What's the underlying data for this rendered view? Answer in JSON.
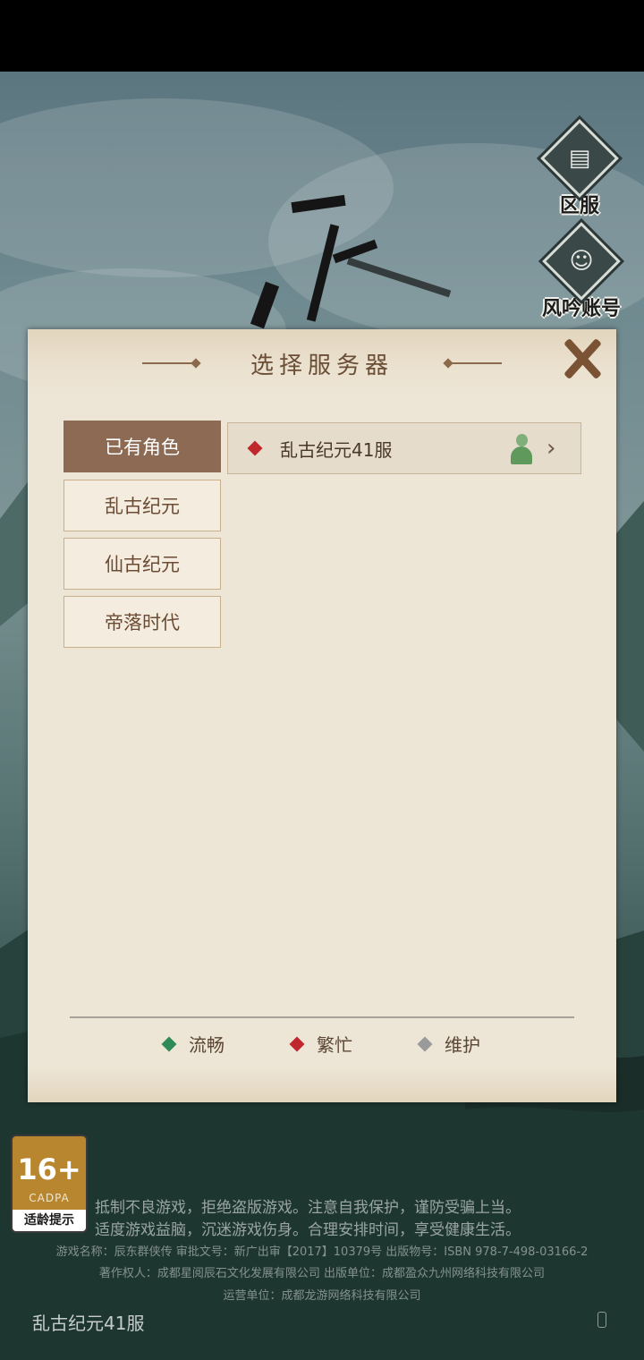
{
  "side_buttons": {
    "server": {
      "label": "区服",
      "icon": "gate-icon"
    },
    "account": {
      "label": "风吟账号",
      "icon": "user-icon"
    }
  },
  "dialog": {
    "title": "选择服务器",
    "close_icon": "close-icon",
    "tabs": [
      {
        "label": "已有角色",
        "active": true
      },
      {
        "label": "乱古纪元",
        "active": false
      },
      {
        "label": "仙古纪元",
        "active": false
      },
      {
        "label": "帝落时代",
        "active": false
      }
    ],
    "servers": [
      {
        "name": "乱古纪元41服",
        "status": "繁忙",
        "status_color": "#c0272d",
        "has_role": true
      }
    ],
    "legend": [
      {
        "label": "流畅",
        "color": "#2e8b57"
      },
      {
        "label": "繁忙",
        "color": "#c0272d"
      },
      {
        "label": "维护",
        "color": "#9a9a9a"
      }
    ]
  },
  "age_rating": {
    "age": "16+",
    "org": "CADPA",
    "tip": "适龄提示"
  },
  "notice": {
    "line1": "抵制不良游戏，拒绝盗版游戏。注意自我保护，谨防受骗上当。",
    "line2": "适度游戏益脑，沉迷游戏伤身。合理安排时间，享受健康生活。"
  },
  "meta": {
    "line1": "游戏名称：辰东群侠传 审批文号：新广出审【2017】10379号 出版物号：ISBN 978-7-498-03166-2",
    "line2": "著作权人：成都星阅辰石文化发展有限公司 出版单位：成都盈众九州网络科技有限公司",
    "line3": "运营单位：成都龙游网络科技有限公司"
  },
  "current_server": "乱古纪元41服"
}
